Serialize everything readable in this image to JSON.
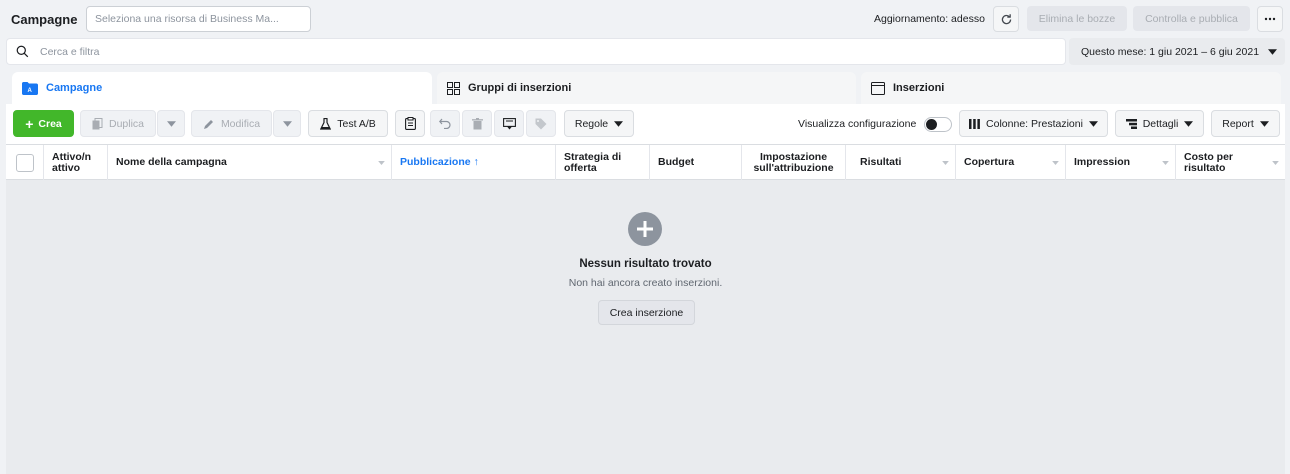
{
  "header": {
    "title": "Campagne",
    "resource_placeholder": "Seleziona una risorsa di Business Ma...",
    "update_status": "Aggiornamento: adesso",
    "delete_drafts_label": "Elimina le bozze",
    "review_publish_label": "Controlla e pubblica",
    "more_icon": "ellipsis-icon",
    "refresh_icon": "refresh-icon"
  },
  "search": {
    "placeholder": "Cerca e filtra",
    "date_range": "Questo mese: 1 giu 2021 – 6 giu 2021"
  },
  "tabs": [
    {
      "label": "Campagne",
      "icon": "folder-icon",
      "active": true
    },
    {
      "label": "Gruppi di inserzioni",
      "icon": "grid-icon",
      "active": false
    },
    {
      "label": "Inserzioni",
      "icon": "ad-icon",
      "active": false
    }
  ],
  "toolbar": {
    "create_label": "Crea",
    "duplicate_label": "Duplica",
    "edit_label": "Modifica",
    "ab_test_label": "Test A/B",
    "rules_label": "Regole",
    "view_config_label": "Visualizza configurazione",
    "columns_label": "Colonne: Prestazioni",
    "details_label": "Dettagli",
    "report_label": "Report"
  },
  "table": {
    "columns": [
      {
        "label": "Attivo/n attivo"
      },
      {
        "label": "Nome della campagna"
      },
      {
        "label": "Pubblicazione ↑",
        "sorted": true
      },
      {
        "label": "Strategia di offerta"
      },
      {
        "label": "Budget"
      },
      {
        "label": "Impostazione sull'attribuzione"
      },
      {
        "label": "Risultati"
      },
      {
        "label": "Copertura"
      },
      {
        "label": "Impression"
      },
      {
        "label": "Costo per risultato"
      }
    ]
  },
  "empty_state": {
    "title": "Nessun risultato trovato",
    "subtitle": "Non hai ancora creato inserzioni.",
    "button_label": "Crea inserzione"
  },
  "colors": {
    "accent": "#1877f2",
    "create_green": "#42b72a",
    "empty_bg": "#e9ebee"
  }
}
